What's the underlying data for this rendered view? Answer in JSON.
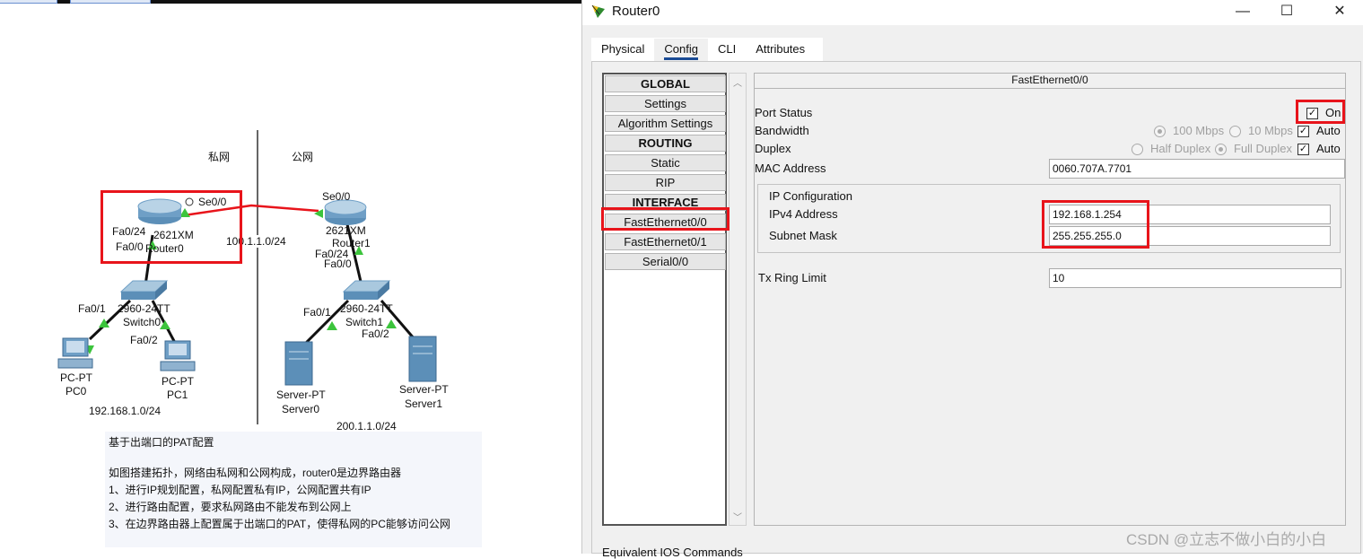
{
  "topology": {
    "zone_private": "私网",
    "zone_public": "公网",
    "router0": {
      "port_se": "Se0/0",
      "model": "2621XM",
      "name": "Router0",
      "port_fa24": "Fa0/24",
      "port_fa0": "Fa0/0"
    },
    "router1": {
      "port_se": "Se0/0",
      "model": "2621XM",
      "name": "Router1",
      "port_fa24": "Fa0/24",
      "port_fa0": "Fa0/0"
    },
    "link_net": "100.1.1.0/24",
    "switch0": {
      "model": "2960-24TT",
      "name": "Switch0",
      "port_fa1": "Fa0/1",
      "port_fa2": "Fa0/2"
    },
    "switch1": {
      "model": "2960-24TT",
      "name": "Switch1",
      "port_fa1": "Fa0/1",
      "port_fa2": "Fa0/2"
    },
    "pc0": {
      "type": "PC-PT",
      "name": "PC0"
    },
    "pc1": {
      "type": "PC-PT",
      "name": "PC1"
    },
    "server0": {
      "type": "Server-PT",
      "name": "Server0"
    },
    "server1": {
      "type": "Server-PT",
      "name": "Server1"
    },
    "private_net": "192.168.1.0/24",
    "public_net": "200.1.1.0/24",
    "note": {
      "title": "基于出端口的PAT配置",
      "line1": "如图搭建拓扑，网络由私网和公网构成，router0是边界路由器",
      "line2": "1、进行IP规划配置，私网配置私有IP，公网配置共有IP",
      "line3": "2、进行路由配置，要求私网路由不能发布到公网上",
      "line4": "3、在边界路由器上配置属于出端口的PAT，使得私网的PC能够访问公网"
    },
    "colors": {
      "link": "#111111",
      "serial": "#e8141b",
      "port_up": "#3cc43c",
      "highlight": "#e8141b"
    }
  },
  "window": {
    "title": "Router0",
    "controls": {
      "minimize": "—",
      "maximize": "☐",
      "close": "✕"
    },
    "tabs": [
      "Physical",
      "Config",
      "CLI",
      "Attributes"
    ],
    "active_tab": "Config",
    "nav": {
      "global": "GLOBAL",
      "settings": "Settings",
      "algorithm": "Algorithm Settings",
      "routing": "ROUTING",
      "static": "Static",
      "rip": "RIP",
      "interface": "INTERFACE",
      "fe00": "FastEthernet0/0",
      "fe01": "FastEthernet0/1",
      "serial00": "Serial0/0"
    },
    "config": {
      "header": "FastEthernet0/0",
      "port_status_label": "Port Status",
      "port_status_on": "On",
      "bandwidth_label": "Bandwidth",
      "bw_100": "100 Mbps",
      "bw_10": "10 Mbps",
      "auto": "Auto",
      "duplex_label": "Duplex",
      "half_duplex": "Half Duplex",
      "full_duplex": "Full Duplex",
      "mac_label": "MAC Address",
      "mac_value": "0060.707A.7701",
      "ip_config_label": "IP Configuration",
      "ipv4_label": "IPv4 Address",
      "ipv4_value": "192.168.1.254",
      "mask_label": "Subnet Mask",
      "mask_value": "255.255.255.0",
      "tx_label": "Tx Ring Limit",
      "tx_value": "10"
    },
    "footer_label": "Equivalent IOS Commands"
  },
  "watermark": "CSDN @立志不做小白的小白"
}
